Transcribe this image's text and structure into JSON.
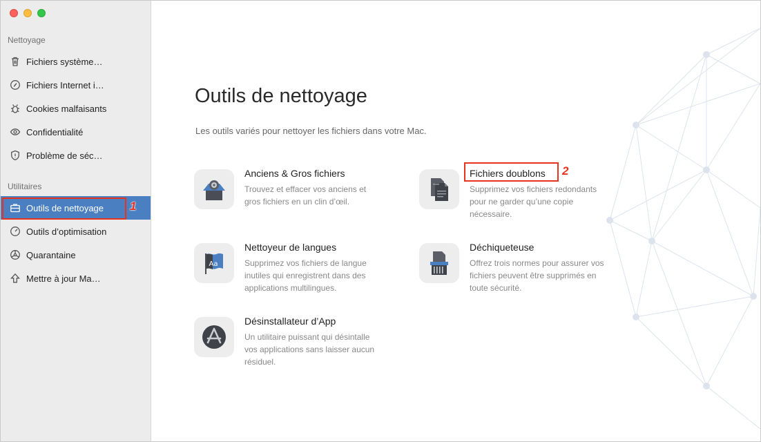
{
  "sidebar": {
    "sections": [
      {
        "label": "Nettoyage"
      },
      {
        "label": "Utilitaires"
      }
    ],
    "items": [
      {
        "label": "Fichiers système…",
        "icon": "trash-icon"
      },
      {
        "label": "Fichiers Internet i…",
        "icon": "compass-icon"
      },
      {
        "label": "Cookies malfaisants",
        "icon": "bug-icon"
      },
      {
        "label": "Confidentialité",
        "icon": "eye-icon"
      },
      {
        "label": "Problème de séc…",
        "icon": "shield-icon"
      },
      {
        "label": "Outils de nettoyage",
        "icon": "briefcase-icon",
        "active": true
      },
      {
        "label": "Outils d’optimisation",
        "icon": "gauge-icon"
      },
      {
        "label": "Quarantaine",
        "icon": "biohazard-icon"
      },
      {
        "label": "Mettre à jour Ma…",
        "icon": "arrow-up-icon"
      }
    ]
  },
  "annotations": [
    {
      "number": "1"
    },
    {
      "number": "2"
    }
  ],
  "main": {
    "title": "Outils de nettoyage",
    "subtitle": "Les outils variés pour nettoyer les fichiers dans votre Mac.",
    "tools": [
      {
        "name": "Anciens & Gros fichiers",
        "desc": "Trouvez et effacer vos anciens et gros fichiers en un clin d’œil.",
        "icon": "large-files-icon"
      },
      {
        "name": "Fichiers doublons",
        "desc": "Supprimez vos fichiers redondants pour ne garder qu’une copie nécessaire.",
        "icon": "duplicate-files-icon"
      },
      {
        "name": "Nettoyeur de langues",
        "desc": "Supprimez vos fichiers de langue inutiles qui enregistrent dans des applications multilingues.",
        "icon": "language-flag-icon"
      },
      {
        "name": "Déchiqueteuse",
        "desc": "Offrez trois normes pour assurer vos fichiers peuvent être supprimés en toute sécurité.",
        "icon": "shredder-icon"
      },
      {
        "name": "Désinstallateur d’App",
        "desc": "Un utilitaire puissant qui désintalle vos applications sans laisser aucun résiduel.",
        "icon": "app-store-icon"
      }
    ]
  },
  "colors": {
    "accent": "#4a7fc1",
    "annotation": "#e8321d"
  }
}
